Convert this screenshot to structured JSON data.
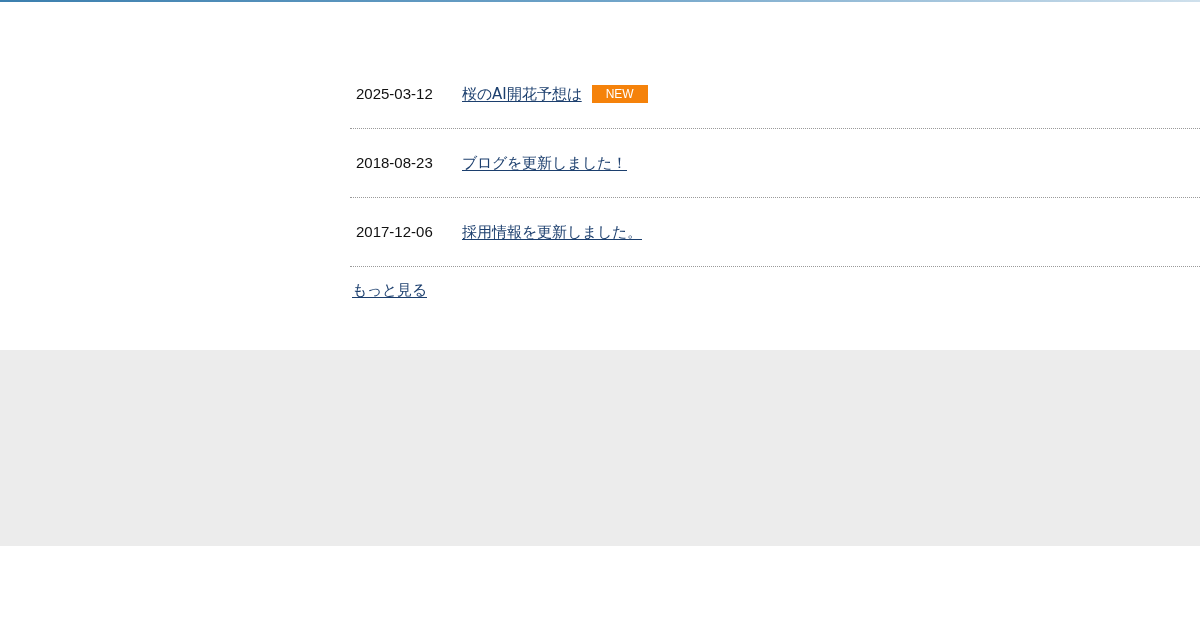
{
  "news": [
    {
      "date": "2025-03-12",
      "title": "桜のAI開花予想は",
      "badge": "NEW"
    },
    {
      "date": "2018-08-23",
      "title": "ブログを更新しました！"
    },
    {
      "date": "2017-12-06",
      "title": "採用情報を更新しました。"
    }
  ],
  "more_link": "もっと見る"
}
